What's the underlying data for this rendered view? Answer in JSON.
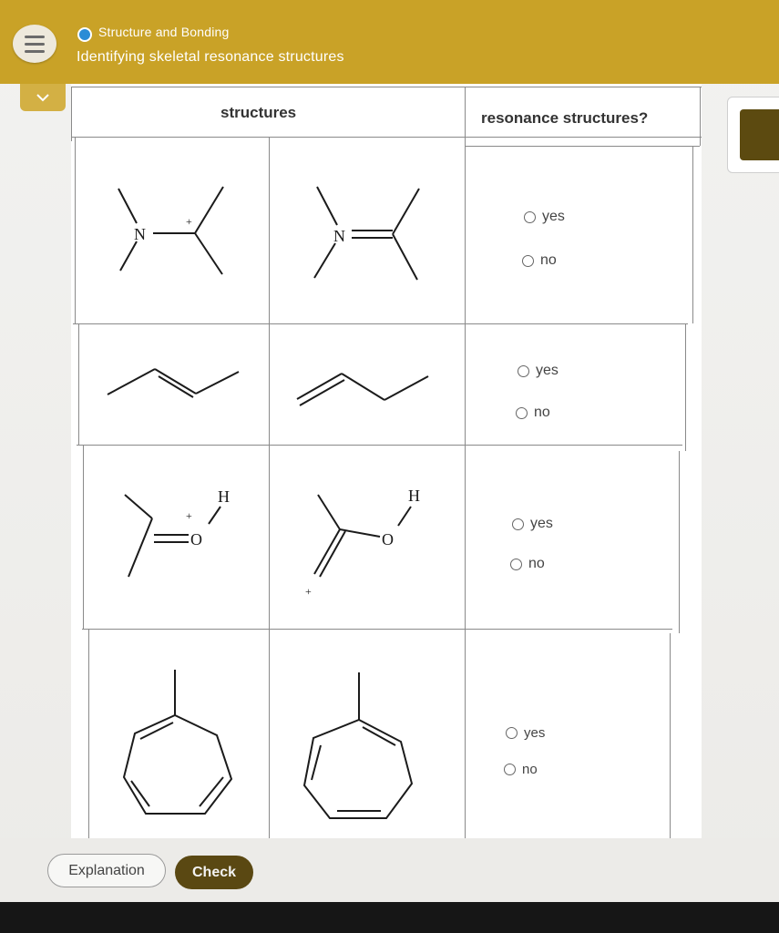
{
  "header": {
    "topic": "Structure and Bonding",
    "title": "Identifying skeletal resonance structures"
  },
  "table": {
    "col_structures": "structures",
    "col_resonance": "resonance structures?",
    "rows": [
      {
        "structure_1": {
          "atoms": [
            "N",
            "+"
          ]
        },
        "structure_2": {
          "atoms": [
            "N"
          ]
        },
        "options": [
          "yes",
          "no"
        ]
      },
      {
        "options": [
          "yes",
          "no"
        ]
      },
      {
        "structure_1": {
          "atoms": [
            "H",
            "+",
            "O"
          ]
        },
        "structure_2": {
          "atoms": [
            "H",
            "O",
            "+"
          ]
        },
        "options": [
          "yes",
          "no"
        ]
      },
      {
        "options": [
          "yes",
          "no"
        ]
      }
    ]
  },
  "footer": {
    "explanation_label": "Explanation",
    "check_label": "Check"
  },
  "colors": {
    "topbar": "#c9a227",
    "check_button": "#5a4812",
    "topic_dot": "#2a8cd6"
  },
  "icons": [
    "menu-icon",
    "chevron-down-icon",
    "radio-icon"
  ]
}
